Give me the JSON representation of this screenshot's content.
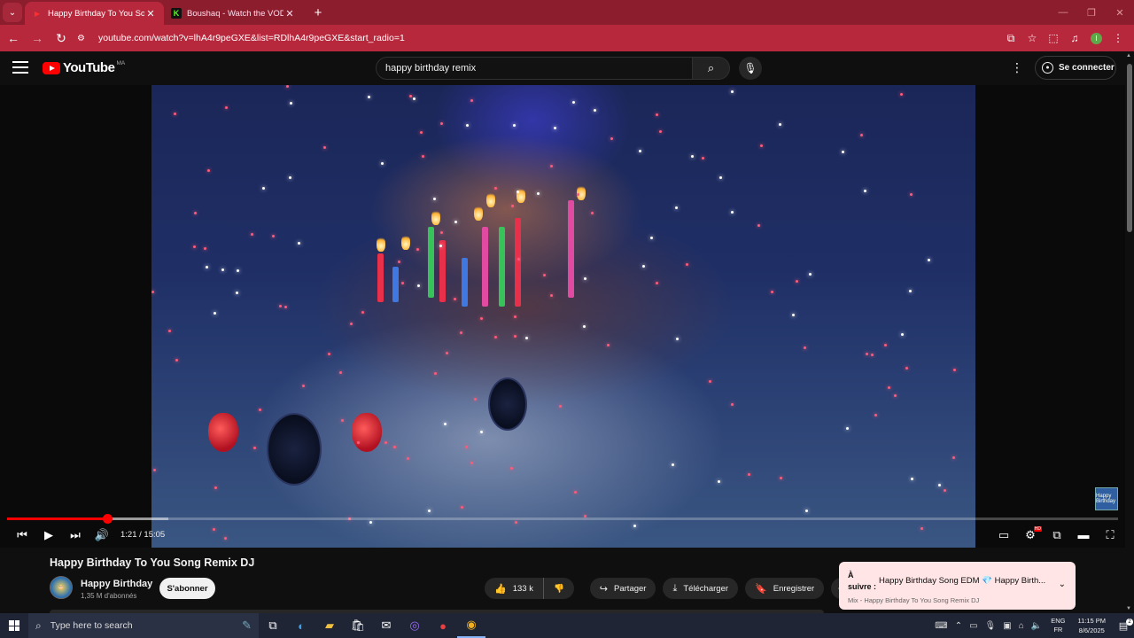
{
  "browser": {
    "tabs": [
      {
        "title": "Happy Birthday To You Song R",
        "favicon": "youtube-icon",
        "active": true
      },
      {
        "title": "Boushaq - Watch the VOD on K",
        "favicon": "kick-icon",
        "active": false
      }
    ],
    "url": "youtube.com/watch?v=lhA4r9peGXE&list=RDlhA4r9peGXE&start_radio=1",
    "profile_initial": "I"
  },
  "youtube": {
    "logo_text": "YouTube",
    "country_code": "MA",
    "search_query": "happy birthday remix",
    "signin_label": "Se connecter"
  },
  "player": {
    "current_time": "1:21",
    "duration": "15:05",
    "time_display": "1:21 / 15:05",
    "played_fraction": 0.09,
    "loaded_fraction": 0.145,
    "hd_badge": "HD",
    "corner_badge": "Happy Birthday"
  },
  "video": {
    "title": "Happy Birthday To You Song Remix DJ",
    "channel": "Happy Birthday",
    "subscribers": "1,35 M d'abonnés",
    "subscribe_label": "S'abonner",
    "likes": "133 k",
    "share_label": "Partager",
    "download_label": "Télécharger",
    "save_label": "Enregistrer"
  },
  "up_next": {
    "label": "À suivre :",
    "title": "Happy Birthday Song EDM 💎 Happy Birth...",
    "mix": "Mix - Happy Birthday To You Song Remix DJ"
  },
  "taskbar": {
    "search_placeholder": "Type here to search",
    "lang_top": "ENG",
    "lang_bottom": "FR",
    "time": "11:15 PM",
    "date": "8/6/2025",
    "notification_count": "2"
  },
  "colors": {
    "chrome_red": "#b8283c",
    "yt_red": "#ff0000",
    "upnext_bg": "#ffe5e5"
  }
}
